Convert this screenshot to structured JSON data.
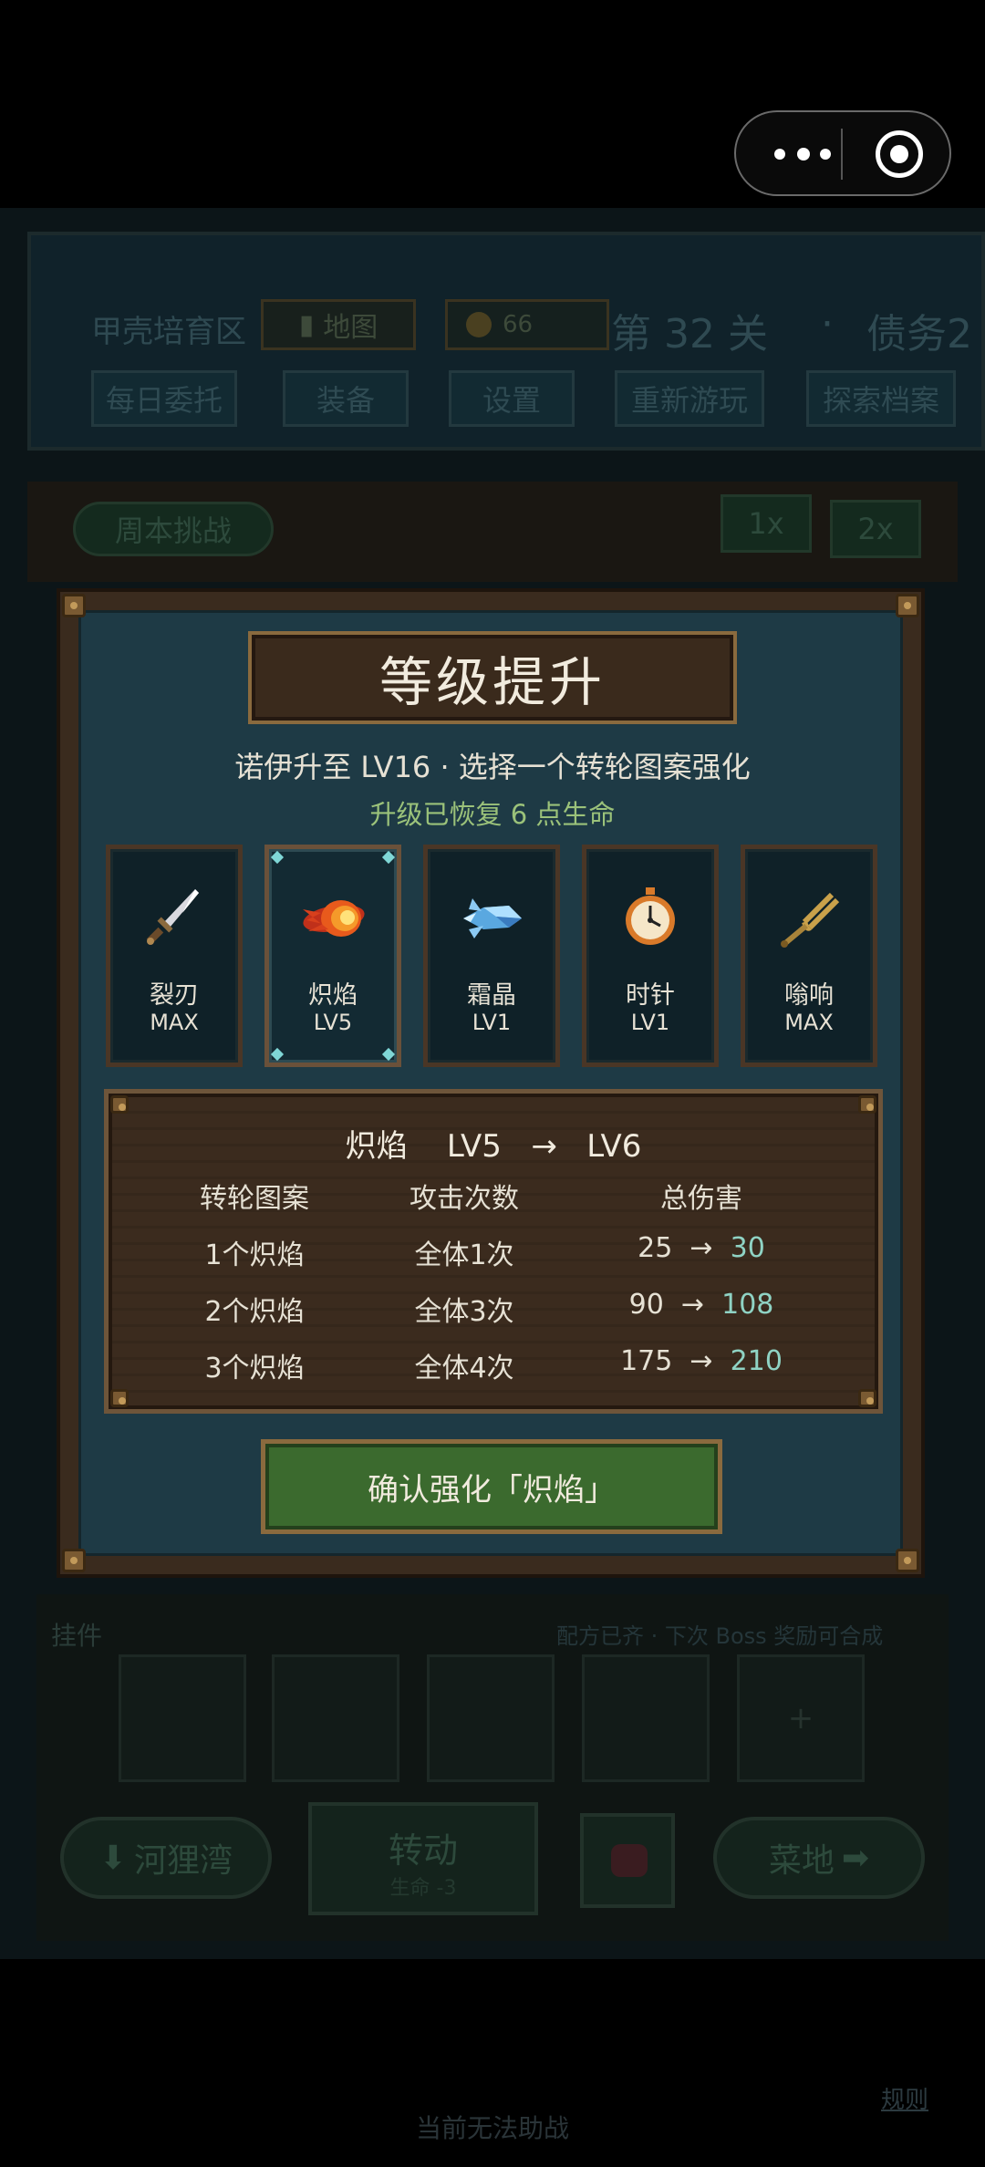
{
  "colors": {
    "accent_heal": "#9bc27a",
    "accent_value": "#8fd3c4",
    "confirm_green": "#3b6a2e",
    "wood": "#3b2b1e",
    "panel_teal": "#1e3a45"
  },
  "background": {
    "area_name": "甲壳培育区",
    "map_label": "地图",
    "coins": "66",
    "stage": "第 32 关",
    "dot": "·",
    "debt": "债务2",
    "tabs": [
      "每日委托",
      "装备",
      "设置",
      "重新游玩",
      "探索档案"
    ],
    "weekly_challenge": "周本挑战",
    "speed_1x": "1x",
    "speed_2x": "2x",
    "charm_label": "挂件",
    "recipe_note": "配方已齐 · 下次 Boss 奖励可合成",
    "plus": "+",
    "left_nav": "河狸湾",
    "spin_label": "转动",
    "spin_cost": "生命 -3",
    "right_nav": "菜地",
    "rules_link": "规则",
    "assist_note": "当前无法助战"
  },
  "modal": {
    "title": "等级提升",
    "subtitle": "诺伊升至 LV16 · 选择一个转轮图案强化",
    "heal_note": "升级已恢复 6 点生命",
    "cards": [
      {
        "icon": "dagger-icon",
        "name": "裂刃",
        "level": "MAX",
        "selected": false
      },
      {
        "icon": "fireball-icon",
        "name": "炽焰",
        "level": "LV5",
        "selected": true
      },
      {
        "icon": "ice-crystal-icon",
        "name": "霜晶",
        "level": "LV1",
        "selected": false
      },
      {
        "icon": "stopwatch-icon",
        "name": "时针",
        "level": "LV1",
        "selected": false
      },
      {
        "icon": "tuning-fork-icon",
        "name": "嗡响",
        "level": "MAX",
        "selected": false
      }
    ],
    "detail": {
      "name": "炽焰",
      "from_level": "LV5",
      "arrow": "→",
      "to_level": "LV6",
      "headers": [
        "转轮图案",
        "攻击次数",
        "总伤害"
      ],
      "rows": [
        {
          "pattern": "1个炽焰",
          "hits": "全体1次",
          "dmg_from": "25",
          "dmg_to": "30"
        },
        {
          "pattern": "2个炽焰",
          "hits": "全体3次",
          "dmg_from": "90",
          "dmg_to": "108"
        },
        {
          "pattern": "3个炽焰",
          "hits": "全体4次",
          "dmg_from": "175",
          "dmg_to": "210"
        }
      ]
    },
    "confirm_label": "确认强化「炽焰」"
  }
}
